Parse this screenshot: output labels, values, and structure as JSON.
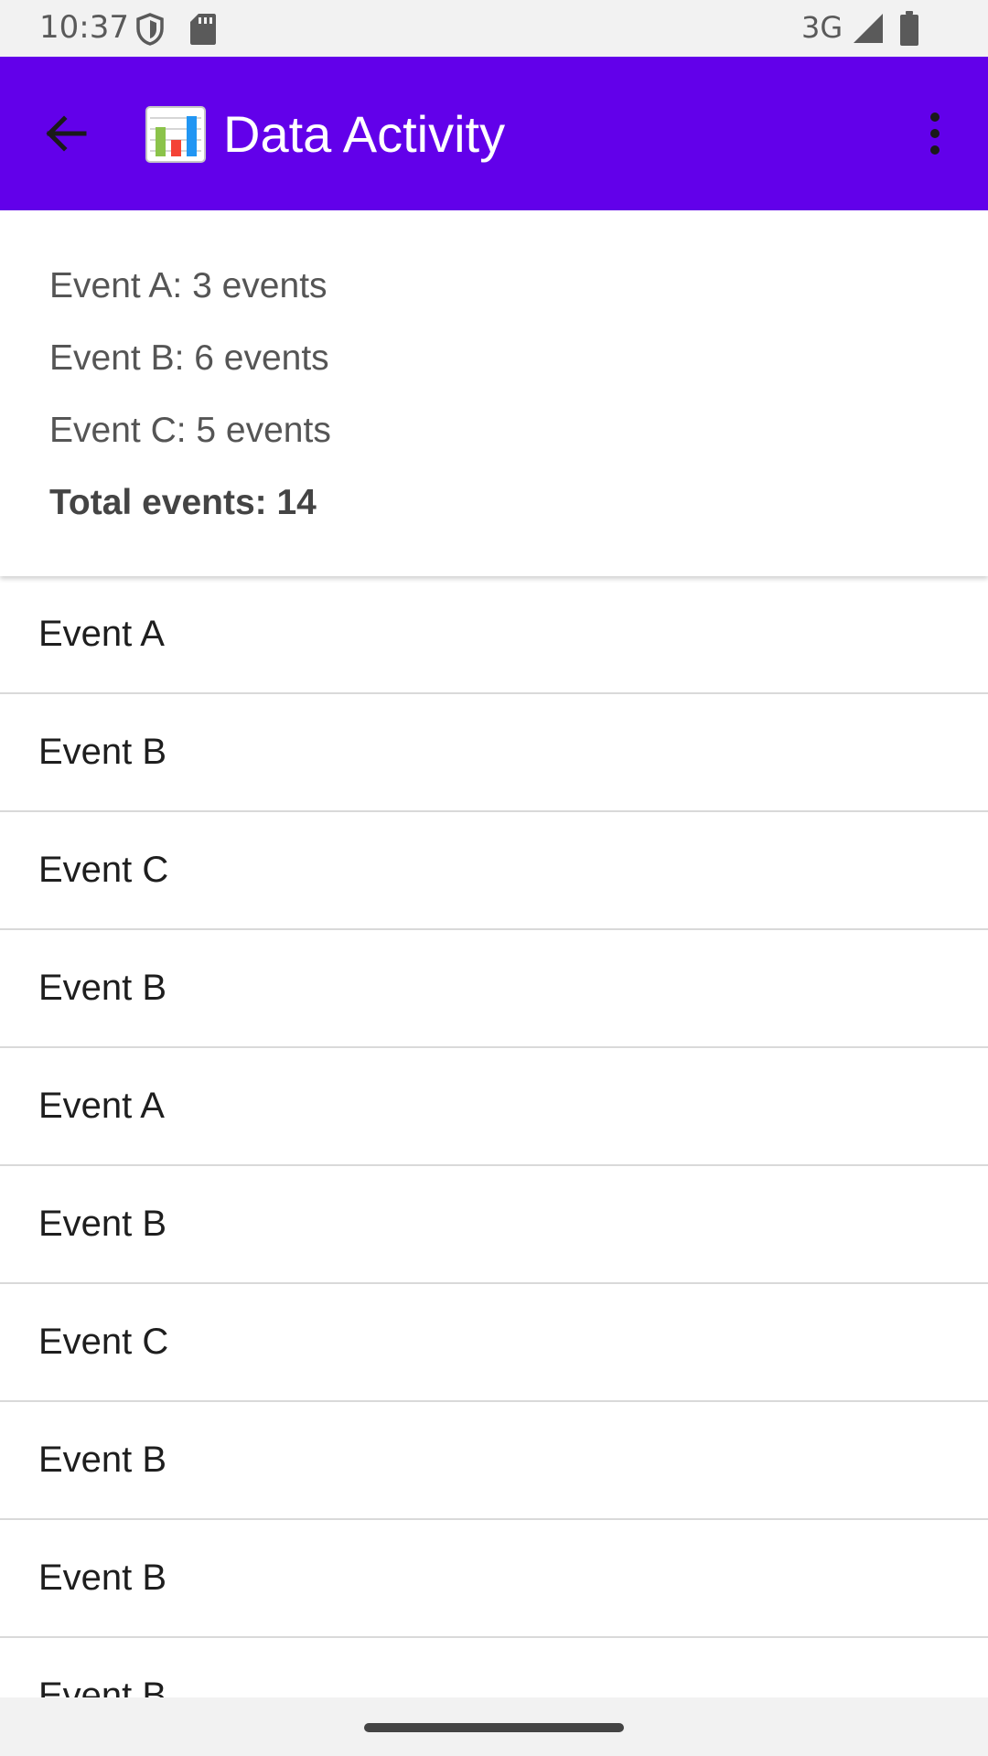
{
  "status_bar": {
    "time": "10:37",
    "network": "3G",
    "icons": [
      "shield-icon",
      "sd-card-icon",
      "signal-icon",
      "battery-icon"
    ]
  },
  "app_bar": {
    "title": "Data Activity",
    "title_emoji_icon": "bar-chart-icon",
    "background": "#6200ea",
    "back_icon": "arrow-back-icon",
    "menu_icon": "more-vert-icon"
  },
  "summary": {
    "lines": [
      "Event A: 3 events",
      "Event B: 6 events",
      "Event C: 5 events"
    ],
    "total": "Total events: 14"
  },
  "events": [
    "Event A",
    "Event B",
    "Event C",
    "Event B",
    "Event A",
    "Event B",
    "Event C",
    "Event B",
    "Event B",
    "Event B"
  ]
}
